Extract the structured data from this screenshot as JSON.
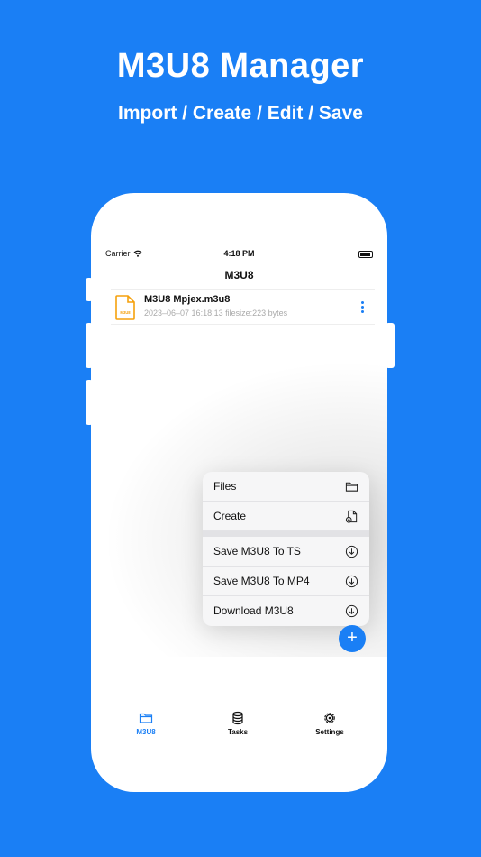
{
  "hero": {
    "title": "M3U8 Manager",
    "subtitle": "Import / Create / Edit / Save"
  },
  "status_bar": {
    "carrier": "Carrier",
    "time": "4:18 PM"
  },
  "nav": {
    "title": "M3U8"
  },
  "files": [
    {
      "name": "M3U8 Mpjex.m3u8",
      "meta": "2023–06–07 16:18:13 filesize:223 bytes",
      "icon_label": "M3U8"
    }
  ],
  "menu": {
    "group1": [
      {
        "label": "Files",
        "icon": "folder-icon"
      },
      {
        "label": "Create",
        "icon": "new-file-icon"
      }
    ],
    "group2": [
      {
        "label": "Save M3U8 To TS",
        "icon": "download-circle-icon"
      },
      {
        "label": "Save M3U8 To MP4",
        "icon": "download-circle-icon"
      },
      {
        "label": "Download M3U8",
        "icon": "download-circle-icon"
      }
    ]
  },
  "fab": {
    "symbol": "+"
  },
  "tabs": [
    {
      "label": "M3U8",
      "icon": "folder-icon",
      "active": true
    },
    {
      "label": "Tasks",
      "icon": "database-icon",
      "active": false
    },
    {
      "label": "Settings",
      "icon": "gear-icon",
      "active": false
    }
  ],
  "colors": {
    "accent": "#1a7ff5",
    "file_icon": "#f5a10d",
    "background": "#1a7ff5"
  }
}
